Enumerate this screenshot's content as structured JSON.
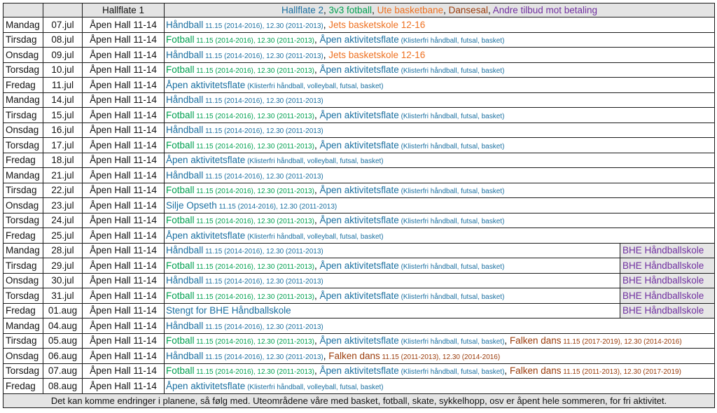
{
  "header": {
    "hall1": "Hallflate 1",
    "legend": [
      {
        "text": "Hallflate 2",
        "color": "blue"
      },
      {
        "text": ", ",
        "color": "dark"
      },
      {
        "text": "3v3 fotball",
        "color": "green"
      },
      {
        "text": ", ",
        "color": "dark"
      },
      {
        "text": "Ute basketbane",
        "color": "orange"
      },
      {
        "text": ", ",
        "color": "dark"
      },
      {
        "text": "Dansesal",
        "color": "brown"
      },
      {
        "text": ", ",
        "color": "dark"
      },
      {
        "text": "Andre tilbud mot betaling",
        "color": "purple"
      }
    ]
  },
  "rows": [
    {
      "day": "Mandag",
      "date": "07.jul",
      "hall1": "Åpen Hall 11-14",
      "segs": [
        {
          "t": "Håndball",
          "c": "blue"
        },
        {
          "t": " 11.15 (2014-2016), 12.30 (2011-2013)",
          "c": "blue",
          "s": true
        },
        {
          "t": ", ",
          "c": "dark"
        },
        {
          "t": "Jets basketskole 12-16",
          "c": "orange"
        }
      ],
      "extra": ""
    },
    {
      "day": "Tirsdag",
      "date": "08.jul",
      "hall1": "Åpen Hall 11-14",
      "segs": [
        {
          "t": "Fotball",
          "c": "green"
        },
        {
          "t": " 11.15 (2014-2016), 12.30 (2011-2013)",
          "c": "green",
          "s": true
        },
        {
          "t": ", ",
          "c": "dark"
        },
        {
          "t": "Åpen aktivitetsflate",
          "c": "blue"
        },
        {
          "t": " (Klisterfri håndball, futsal, basket)",
          "c": "blue",
          "s": true
        }
      ],
      "extra": ""
    },
    {
      "day": "Onsdag",
      "date": "09.jul",
      "hall1": "Åpen Hall 11-14",
      "segs": [
        {
          "t": "Håndball",
          "c": "blue"
        },
        {
          "t": " 11.15 (2014-2016), 12.30 (2011-2013)",
          "c": "blue",
          "s": true
        },
        {
          "t": ", ",
          "c": "dark"
        },
        {
          "t": "Jets basketskole 12-16",
          "c": "orange"
        }
      ],
      "extra": ""
    },
    {
      "day": "Torsdag",
      "date": "10.jul",
      "hall1": "Åpen Hall 11-14",
      "segs": [
        {
          "t": "Fotball",
          "c": "green"
        },
        {
          "t": " 11.15 (2014-2016), 12.30 (2011-2013)",
          "c": "green",
          "s": true
        },
        {
          "t": ", ",
          "c": "dark"
        },
        {
          "t": "Åpen aktivitetsflate",
          "c": "blue"
        },
        {
          "t": " (Klisterfri håndball, futsal, basket)",
          "c": "blue",
          "s": true
        }
      ],
      "extra": ""
    },
    {
      "day": "Fredag",
      "date": "11.jul",
      "hall1": "Åpen Hall 11-14",
      "segs": [
        {
          "t": "Åpen aktivitetsflate",
          "c": "blue"
        },
        {
          "t": " (Klisterfri håndball, volleyball, futsal, basket)",
          "c": "blue",
          "s": true
        }
      ],
      "extra": ""
    },
    {
      "day": "Mandag",
      "date": "14.jul",
      "hall1": "Åpen Hall 11-14",
      "segs": [
        {
          "t": "Håndball",
          "c": "blue"
        },
        {
          "t": " 11.15 (2014-2016), 12.30 (2011-2013)",
          "c": "blue",
          "s": true
        }
      ],
      "extra": ""
    },
    {
      "day": "Tirsdag",
      "date": "15.jul",
      "hall1": "Åpen Hall 11-14",
      "segs": [
        {
          "t": "Fotball",
          "c": "green"
        },
        {
          "t": " 11.15 (2014-2016), 12.30 (2011-2013)",
          "c": "green",
          "s": true
        },
        {
          "t": ", ",
          "c": "dark"
        },
        {
          "t": "Åpen aktivitetsflate",
          "c": "blue"
        },
        {
          "t": " (Klisterfri håndball, futsal, basket)",
          "c": "blue",
          "s": true
        }
      ],
      "extra": ""
    },
    {
      "day": "Onsdag",
      "date": "16.jul",
      "hall1": "Åpen Hall 11-14",
      "segs": [
        {
          "t": "Håndball",
          "c": "blue"
        },
        {
          "t": " 11.15 (2014-2016), 12.30 (2011-2013)",
          "c": "blue",
          "s": true
        }
      ],
      "extra": ""
    },
    {
      "day": "Torsdag",
      "date": "17.jul",
      "hall1": "Åpen Hall 11-14",
      "segs": [
        {
          "t": "Fotball",
          "c": "green"
        },
        {
          "t": " 11.15 (2014-2016), 12.30 (2011-2013)",
          "c": "green",
          "s": true
        },
        {
          "t": ", ",
          "c": "dark"
        },
        {
          "t": "Åpen aktivitetsflate",
          "c": "blue"
        },
        {
          "t": " (Klisterfri håndball, futsal, basket)",
          "c": "blue",
          "s": true
        }
      ],
      "extra": ""
    },
    {
      "day": "Fredag",
      "date": "18.jul",
      "hall1": "Åpen Hall 11-14",
      "segs": [
        {
          "t": "Åpen aktivitetsflate",
          "c": "blue"
        },
        {
          "t": " (Klisterfri håndball, volleyball, futsal, basket)",
          "c": "blue",
          "s": true
        }
      ],
      "extra": ""
    },
    {
      "day": "Mandag",
      "date": "21.jul",
      "hall1": "Åpen Hall 11-14",
      "segs": [
        {
          "t": "Håndball",
          "c": "blue"
        },
        {
          "t": " 11.15 (2014-2016), 12.30 (2011-2013)",
          "c": "blue",
          "s": true
        }
      ],
      "extra": ""
    },
    {
      "day": "Tirsdag",
      "date": "22.jul",
      "hall1": "Åpen Hall 11-14",
      "segs": [
        {
          "t": "Fotball",
          "c": "green"
        },
        {
          "t": " 11.15 (2014-2016), 12.30 (2011-2013)",
          "c": "green",
          "s": true
        },
        {
          "t": ", ",
          "c": "dark"
        },
        {
          "t": "Åpen aktivitetsflate",
          "c": "blue"
        },
        {
          "t": " (Klisterfri håndball, futsal, basket)",
          "c": "blue",
          "s": true
        }
      ],
      "extra": ""
    },
    {
      "day": "Onsdag",
      "date": "23.jul",
      "hall1": "Åpen Hall 11-14",
      "segs": [
        {
          "t": "Silje Opseth",
          "c": "blue"
        },
        {
          "t": " 11.15 (2014-2016), 12.30 (2011-2013)",
          "c": "blue",
          "s": true
        }
      ],
      "extra": ""
    },
    {
      "day": "Torsdag",
      "date": "24.jul",
      "hall1": "Åpen Hall 11-14",
      "segs": [
        {
          "t": "Fotball",
          "c": "green"
        },
        {
          "t": " 11.15 (2014-2016), 12.30 (2011-2013)",
          "c": "green",
          "s": true
        },
        {
          "t": ", ",
          "c": "dark"
        },
        {
          "t": "Åpen aktivitetsflate",
          "c": "blue"
        },
        {
          "t": " (Klisterfri håndball, futsal, basket)",
          "c": "blue",
          "s": true
        }
      ],
      "extra": ""
    },
    {
      "day": "Fredag",
      "date": "25.jul",
      "hall1": "Åpen Hall 11-14",
      "segs": [
        {
          "t": "Åpen aktivitetsflate",
          "c": "blue"
        },
        {
          "t": " (Klisterfri håndball, volleyball, futsal, basket)",
          "c": "blue",
          "s": true
        }
      ],
      "extra": ""
    },
    {
      "day": "Mandag",
      "date": "28.jul",
      "hall1": "Åpen Hall 11-14",
      "segs": [
        {
          "t": "Håndball",
          "c": "blue"
        },
        {
          "t": " 11.15 (2014-2016), 12.30 (2011-2013)",
          "c": "blue",
          "s": true
        }
      ],
      "extra": "BHE Håndballskole"
    },
    {
      "day": "Tirsdag",
      "date": "29.jul",
      "hall1": "Åpen Hall 11-14",
      "segs": [
        {
          "t": "Fotball",
          "c": "green"
        },
        {
          "t": " 11.15 (2014-2016), 12.30 (2011-2013)",
          "c": "green",
          "s": true
        },
        {
          "t": ", ",
          "c": "dark"
        },
        {
          "t": "Åpen aktivitetsflate",
          "c": "blue"
        },
        {
          "t": " (Klisterfri håndball, futsal, basket)",
          "c": "blue",
          "s": true
        }
      ],
      "extra": "BHE Håndballskole"
    },
    {
      "day": "Onsdag",
      "date": "30.jul",
      "hall1": "Åpen Hall 11-14",
      "segs": [
        {
          "t": "Håndball",
          "c": "blue"
        },
        {
          "t": " 11.15 (2014-2016), 12.30 (2011-2013)",
          "c": "blue",
          "s": true
        }
      ],
      "extra": "BHE Håndballskole"
    },
    {
      "day": "Torsdag",
      "date": "31.jul",
      "hall1": "Åpen Hall 11-14",
      "segs": [
        {
          "t": "Fotball",
          "c": "green"
        },
        {
          "t": " 11.15 (2014-2016), 12.30 (2011-2013)",
          "c": "green",
          "s": true
        },
        {
          "t": ", ",
          "c": "dark"
        },
        {
          "t": "Åpen aktivitetsflate",
          "c": "blue"
        },
        {
          "t": " (Klisterfri håndball, futsal, basket)",
          "c": "blue",
          "s": true
        }
      ],
      "extra": "BHE Håndballskole"
    },
    {
      "day": "Fredag",
      "date": "01.aug",
      "hall1": "Åpen Hall 11-14",
      "segs": [
        {
          "t": "Stengt for BHE Håndballskole",
          "c": "blue"
        }
      ],
      "extra": "BHE Håndballskole"
    },
    {
      "day": "Mandag",
      "date": "04.aug",
      "hall1": "Åpen Hall 11-14",
      "segs": [
        {
          "t": "Håndball",
          "c": "blue"
        },
        {
          "t": " 11.15 (2014-2016), 12.30 (2011-2013)",
          "c": "blue",
          "s": true
        }
      ],
      "extra": ""
    },
    {
      "day": "Tirsdag",
      "date": "05.aug",
      "hall1": "Åpen Hall 11-14",
      "segs": [
        {
          "t": "Fotball",
          "c": "green"
        },
        {
          "t": " 11.15 (2014-2016), 12.30 (2011-2013)",
          "c": "green",
          "s": true
        },
        {
          "t": ", ",
          "c": "dark"
        },
        {
          "t": "Åpen aktivitetsflate",
          "c": "blue"
        },
        {
          "t": " (Klisterfri håndball, futsal, basket)",
          "c": "blue",
          "s": true
        },
        {
          "t": ", ",
          "c": "dark"
        },
        {
          "t": "Falken dans",
          "c": "brown"
        },
        {
          "t": "  11.15 (2017-2019), 12.30  (2014-2016)",
          "c": "brown",
          "s": true
        }
      ],
      "extra": ""
    },
    {
      "day": "Onsdag",
      "date": "06.aug",
      "hall1": "Åpen Hall 11-14",
      "segs": [
        {
          "t": "Håndball",
          "c": "blue"
        },
        {
          "t": " 11.15 (2014-2016), 12.30 (2011-2013)",
          "c": "blue",
          "s": true
        },
        {
          "t": ", ",
          "c": "dark"
        },
        {
          "t": "Falken dans",
          "c": "brown"
        },
        {
          "t": "  11.15 (2011-2013), 12.30  (2014-2016)",
          "c": "brown",
          "s": true
        }
      ],
      "extra": ""
    },
    {
      "day": "Torsdag",
      "date": "07.aug",
      "hall1": "Åpen Hall 11-14",
      "segs": [
        {
          "t": "Fotball",
          "c": "green"
        },
        {
          "t": " 11.15 (2014-2016), 12.30 (2011-2013)",
          "c": "green",
          "s": true
        },
        {
          "t": ", ",
          "c": "dark"
        },
        {
          "t": "Åpen aktivitetsflate",
          "c": "blue"
        },
        {
          "t": " (Klisterfri håndball, futsal, basket)",
          "c": "blue",
          "s": true
        },
        {
          "t": ", ",
          "c": "dark"
        },
        {
          "t": "Falken dans",
          "c": "brown"
        },
        {
          "t": "  11.15 (2011-2013), 12.30  (2017-2019)",
          "c": "brown",
          "s": true
        }
      ],
      "extra": ""
    },
    {
      "day": "Fredag",
      "date": "08.aug",
      "hall1": "Åpen Hall 11-14",
      "segs": [
        {
          "t": "Åpen aktivitetsflate",
          "c": "blue"
        },
        {
          "t": " (Klisterfri håndball, volleyball, futsal, basket)",
          "c": "blue",
          "s": true
        }
      ],
      "extra": ""
    }
  ],
  "footer": "Det kan komme endringer i planene, så følg med. Uteområdene våre med basket, fotball, skate, sykkelhopp, osv er åpent hele sommeren, for fri aktivitet."
}
